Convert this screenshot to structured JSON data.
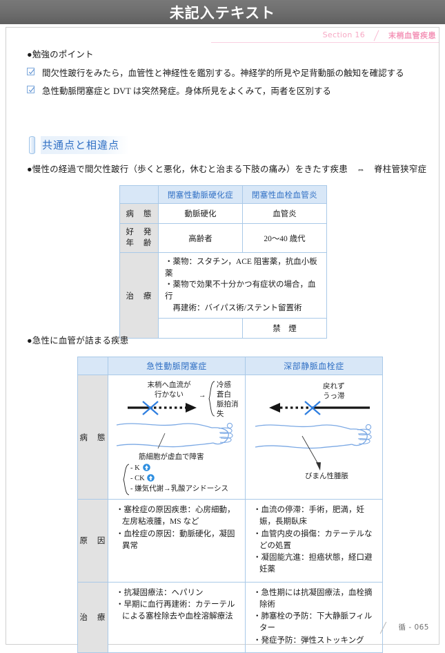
{
  "window": {
    "title": "未記入テキスト"
  },
  "runhead": {
    "section": "Section 16",
    "subject": "末梢血管疾患"
  },
  "study_points": {
    "heading": "●勉強のポイント",
    "items": [
      "間欠性跛行をみたら，血管性と神経性を鑑別する。神経学的所見や足背動脈の触知を確認する",
      "急性動脈閉塞症と DVT は突然発症。身体所見をよくみて，両者を区別する"
    ]
  },
  "section_heading": {
    "label": "共通点と相違点"
  },
  "lines": {
    "chronic": "●慢性の経過で間欠性跛行（歩くと悪化，休むと治まる下肢の痛み）をきたす疾患　⇔　脊柱管狭窄症",
    "acute": "●急性に血管が詰まる疾患"
  },
  "table1": {
    "corner": "",
    "columns": [
      "閉塞性動脈硬化症",
      "閉塞性血栓血管炎"
    ],
    "rows": [
      {
        "header": "病　態",
        "cells": [
          "動脈硬化",
          "血管炎"
        ]
      },
      {
        "header": "好　発\n年　齢",
        "header_l1": "好　発",
        "header_l2": "年　齢",
        "cells": [
          "高齢者",
          "20〜40 歳代"
        ]
      }
    ],
    "treatment": {
      "header": "治　療",
      "merged": "・薬物：スタチン，ACE 阻害薬，抗血小板薬\n・薬物で効果不十分かつ有症状の場合，血行\n　再建術：バイパス術/ステント留置術",
      "merged_l1": "・薬物：スタチン，ACE 阻害薬，抗血小板薬",
      "merged_l2": "・薬物で効果不十分かつ有症状の場合，血行",
      "merged_l3": "　再建術：バイパス術/ステント留置術",
      "sub_left": "",
      "sub_right": "禁　煙"
    }
  },
  "table2": {
    "corner": "",
    "columns": [
      "急性動脈閉塞症",
      "深部静脈血栓症"
    ],
    "rows": [
      {
        "header": "病　態",
        "figure_left": {
          "caption_l1": "末梢へ血流が",
          "caption_l2": "行かない",
          "arrow": "→",
          "effects": [
            "冷感",
            "蒼白",
            "脈拍消失"
          ],
          "limb_caption": "筋細胞が虚血で障害",
          "findings": [
            "- K",
            "- CK",
            "- 嫌気代謝→乳酸アシドーシス"
          ],
          "finding_k": "- K",
          "finding_ck": "- CK",
          "finding_anaerobic": "- 嫌気代謝→乳酸アシドーシス"
        },
        "figure_right": {
          "caption_l1": "戻れず",
          "caption_l2": "うっ滞",
          "limb_caption": "びまん性腫脹"
        }
      },
      {
        "header": "原　因",
        "left": [
          "・塞栓症の原因疾患：心房細動，左房粘液腫，MS など",
          "・血栓症の原因：動脈硬化，凝固異常"
        ],
        "right": [
          "・血流の停滞：手術，肥満，妊娠，長期臥床",
          "・血管内皮の損傷：カテーテルなどの処置",
          "・凝固能亢進：担癌状態，経口避妊薬"
        ]
      },
      {
        "header": "治　療",
        "left": [
          "・抗凝固療法：ヘパリン",
          "・早期に血行再建術：カテーテルによる塞栓除去や血栓溶解療法"
        ],
        "right": [
          "・急性期には抗凝固療法，血栓摘除術",
          "・肺塞栓の予防：下大静脈フィルター",
          "・発症予防：弾性ストッキング"
        ]
      }
    ]
  },
  "footer": {
    "page": "循 - 065"
  },
  "colors": {
    "title_bar": "#6e6e6e",
    "accent_blue": "#2f6fc4",
    "table_header_bg": "#d8e7f7",
    "row_header_bg": "#e2e2e2",
    "border_blue": "#a9c9e8",
    "runhead_pink": "#f7a8c4",
    "limb_blue": "#6f9fe0"
  }
}
